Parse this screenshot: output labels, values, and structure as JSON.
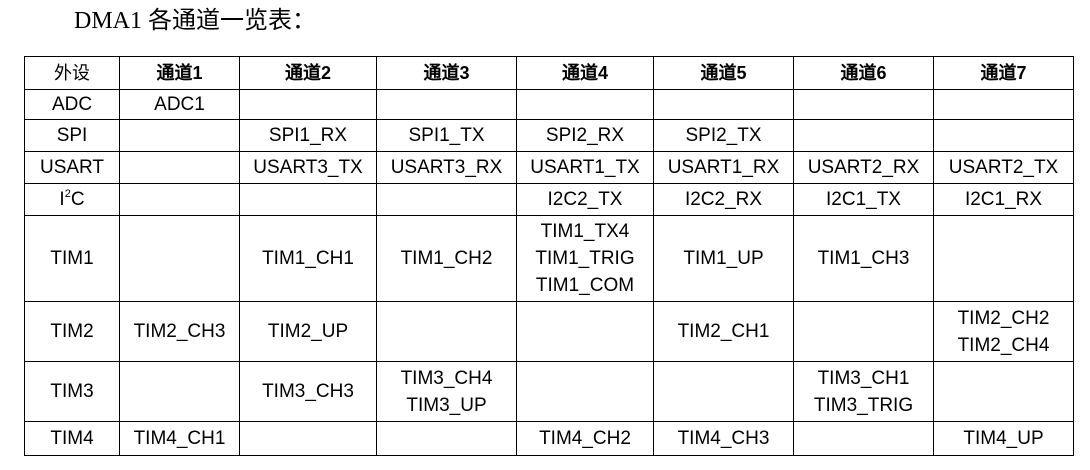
{
  "title": "DMA1 各通道一览表：",
  "table": {
    "headers": [
      "外设",
      "通道1",
      "通道2",
      "通道3",
      "通道4",
      "通道5",
      "通道6",
      "通道7"
    ],
    "rows": [
      {
        "peripheral": "ADC",
        "cells": [
          [
            "ADC1"
          ],
          [],
          [],
          [],
          [],
          [],
          []
        ]
      },
      {
        "peripheral": "SPI",
        "cells": [
          [],
          [
            "SPI1_RX"
          ],
          [
            "SPI1_TX"
          ],
          [
            "SPI2_RX"
          ],
          [
            "SPI2_TX"
          ],
          [],
          []
        ]
      },
      {
        "peripheral": "USART",
        "cells": [
          [],
          [
            "USART3_TX"
          ],
          [
            "USART3_RX"
          ],
          [
            "USART1_TX"
          ],
          [
            "USART1_RX"
          ],
          [
            "USART2_RX"
          ],
          [
            "USART2_TX"
          ]
        ]
      },
      {
        "peripheral": "I",
        "peripheral_sup": "2",
        "peripheral_suffix": "C",
        "cells": [
          [],
          [],
          [],
          [
            "I2C2_TX"
          ],
          [
            "I2C2_RX"
          ],
          [
            "I2C1_TX"
          ],
          [
            "I2C1_RX"
          ]
        ]
      },
      {
        "peripheral": "TIM1",
        "cells": [
          [],
          [
            "TIM1_CH1"
          ],
          [
            "TIM1_CH2"
          ],
          [
            "TIM1_TX4",
            "TIM1_TRIG",
            "TIM1_COM"
          ],
          [
            "TIM1_UP"
          ],
          [
            "TIM1_CH3"
          ],
          []
        ]
      },
      {
        "peripheral": "TIM2",
        "cells": [
          [
            "TIM2_CH3"
          ],
          [
            "TIM2_UP"
          ],
          [],
          [],
          [
            "TIM2_CH1"
          ],
          [],
          [
            "TIM2_CH2",
            "TIM2_CH4"
          ]
        ]
      },
      {
        "peripheral": "TIM3",
        "cells": [
          [],
          [
            "TIM3_CH3"
          ],
          [
            "TIM3_CH4",
            "TIM3_UP"
          ],
          [],
          [],
          [
            "TIM3_CH1",
            "TIM3_TRIG"
          ],
          []
        ]
      },
      {
        "peripheral": "TIM4",
        "cells": [
          [
            "TIM4_CH1"
          ],
          [],
          [],
          [
            "TIM4_CH2"
          ],
          [
            "TIM4_CH3"
          ],
          [],
          [
            "TIM4_UP"
          ]
        ]
      }
    ]
  }
}
